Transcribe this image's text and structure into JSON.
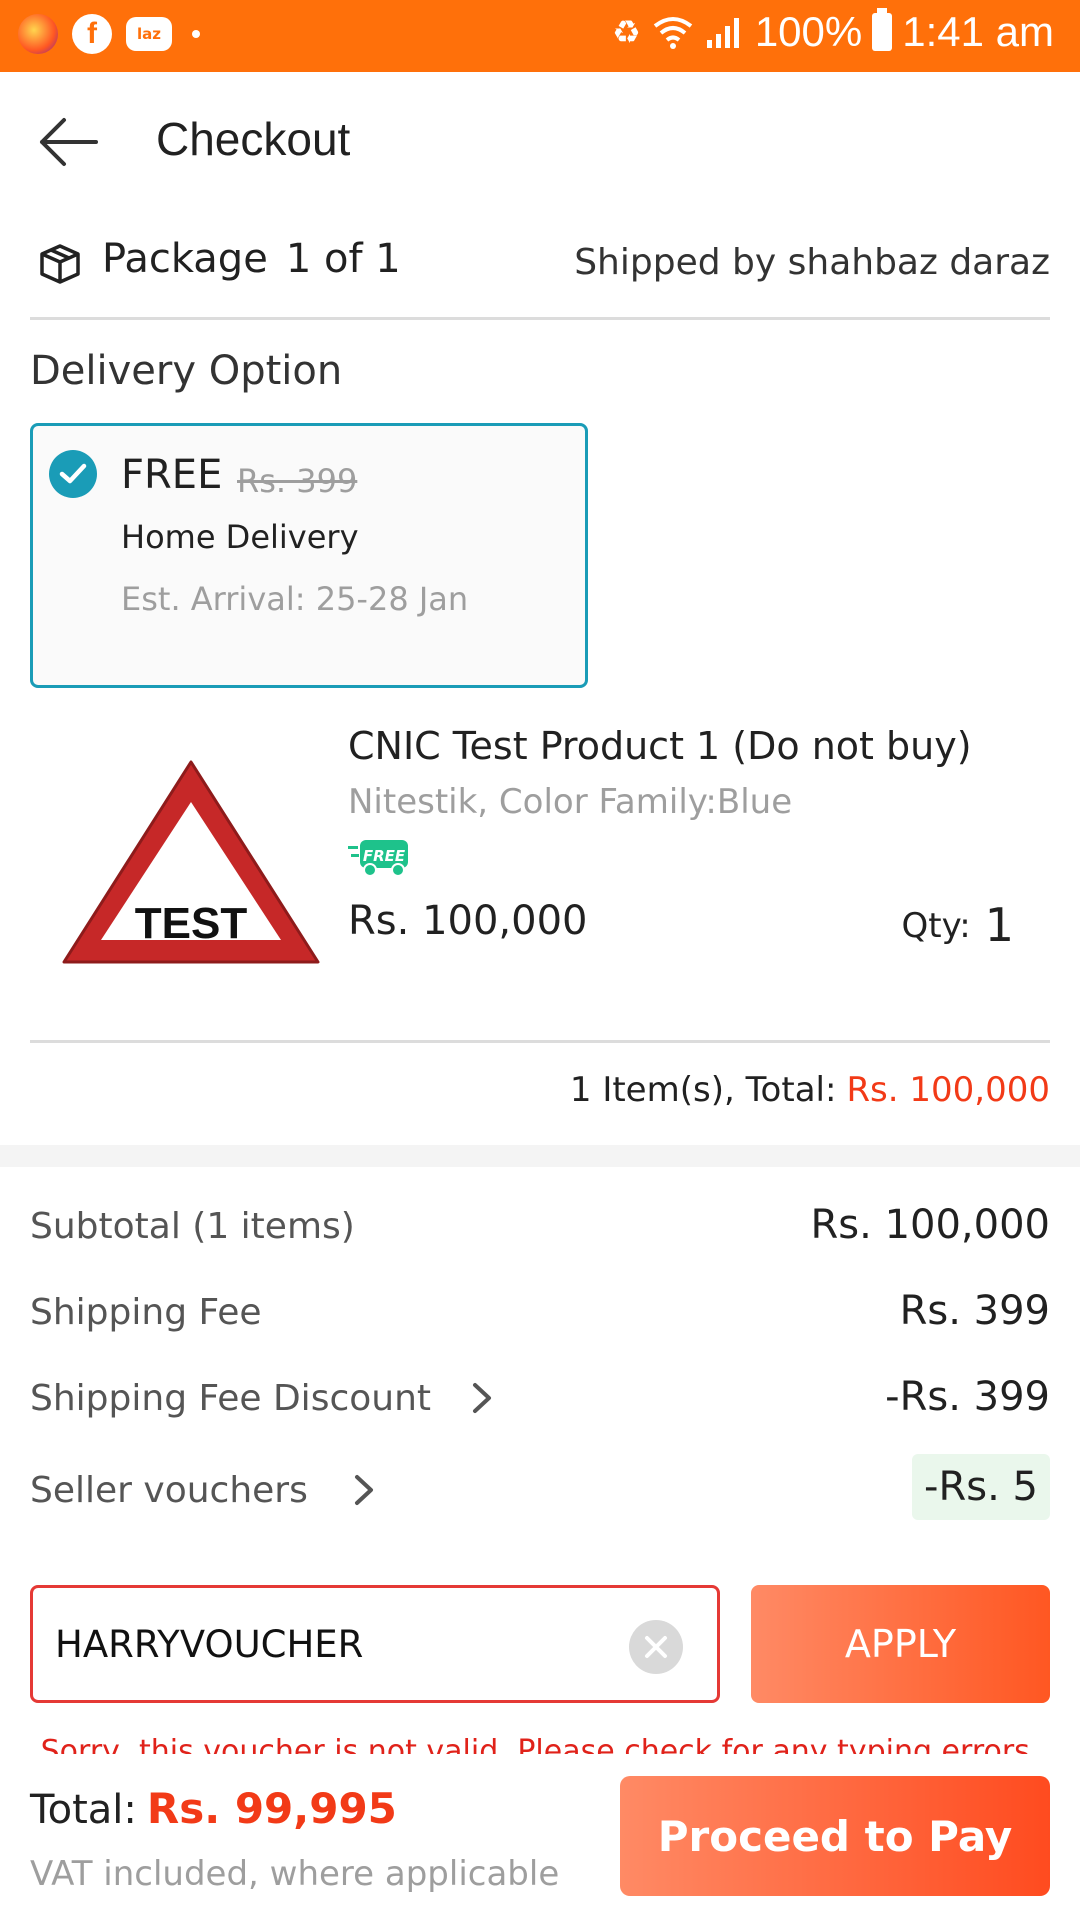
{
  "status_bar": {
    "battery": "100%",
    "time": "1:41 am",
    "laz_label": "laz"
  },
  "header": {
    "title": "Checkout"
  },
  "package": {
    "label": "Package",
    "count": "1 of 1",
    "shipped_by": "Shipped by shahbaz daraz"
  },
  "delivery": {
    "heading": "Delivery Option",
    "price": "FREE",
    "original_price": "Rs. 399",
    "type": "Home Delivery",
    "eta": "Est. Arrival: 25-28 Jan",
    "selected": true
  },
  "product": {
    "title": "CNIC Test Product 1 (Do not buy)",
    "meta": "Nitestik, Color Family:Blue",
    "badge": "FREE",
    "image_text": "TEST",
    "price": "Rs. 100,000",
    "qty_label": "Qty:",
    "qty": "1"
  },
  "items_total": {
    "label": "1 Item(s), Total:",
    "amount": "Rs. 100,000"
  },
  "summary": {
    "subtotal_label": "Subtotal (1 items)",
    "subtotal_value": "Rs. 100,000",
    "shipping_label": "Shipping Fee",
    "shipping_value": "Rs. 399",
    "shipping_discount_label": "Shipping Fee Discount",
    "shipping_discount_value": "-Rs. 399",
    "seller_vouchers_label": "Seller vouchers",
    "seller_vouchers_value": "-Rs. 5"
  },
  "voucher": {
    "value": "HARRYVOUCHER",
    "apply_label": "APPLY",
    "error": "Sorry, this voucher is not valid. Please check for any typing errors."
  },
  "footer": {
    "total_label": "Total:",
    "total_amount": "Rs. 99,995",
    "vat_note": "VAT included, where applicable",
    "pay_label": "Proceed to Pay"
  },
  "colors": {
    "status_bar": "#ff700a",
    "accent_blue": "#1a9cb7",
    "price_red": "#f23a17",
    "error_red": "#e53935",
    "button_orange": "#ff5722"
  },
  "icons": [
    "firefox-icon",
    "facebook-icon",
    "laz-icon",
    "back-arrow-icon",
    "package-box-icon",
    "check-circle-icon",
    "free-delivery-badge-icon",
    "chevron-right-icon",
    "clear-input-icon"
  ]
}
